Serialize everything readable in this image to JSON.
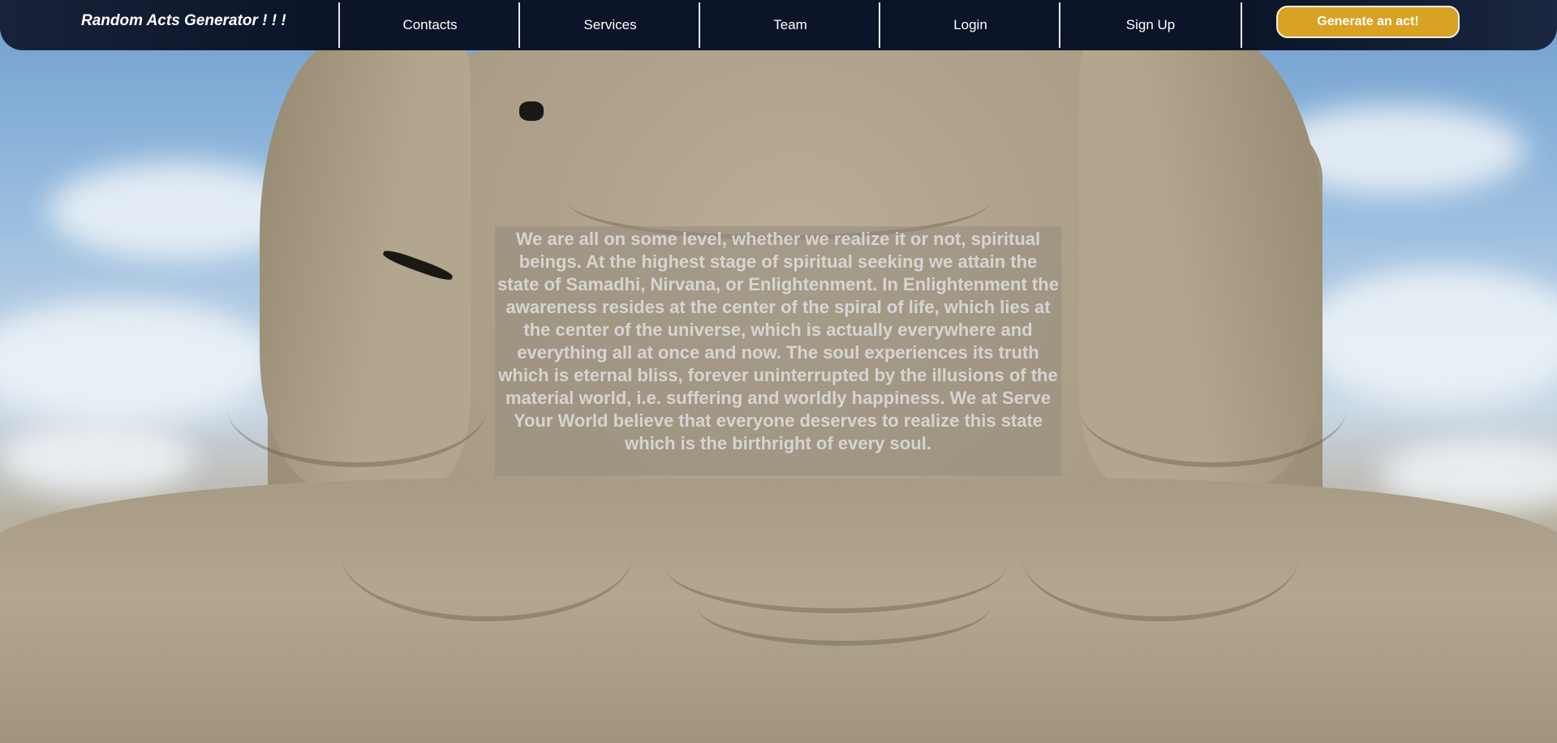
{
  "navbar": {
    "brand": "Random Acts Generator ! ! !",
    "items": [
      {
        "label": "Contacts"
      },
      {
        "label": "Services"
      },
      {
        "label": "Team"
      },
      {
        "label": "Login"
      },
      {
        "label": "Sign Up"
      }
    ],
    "cta_label": "Generate an act!"
  },
  "hero": {
    "quote": "We are all on some level, whether we realize it or not, spiritual beings. At the highest stage of spiritual seeking we attain the state of Samadhi, Nirvana, or Enlightenment. In Enlightenment the awareness resides at the center of the spiral of life, which lies at the center of the universe, which is actually everywhere and everything all at once and now. The soul experiences its truth which is eternal bliss, forever uninterrupted by the illusions of the material world, i.e. suffering and worldly happiness. We at Serve Your World believe that everyone deserves to realize this state which is the birthright of every soul."
  },
  "colors": {
    "navbar": "#0b1428",
    "cta": "#d9a224",
    "nav_text": "#ffffff"
  }
}
